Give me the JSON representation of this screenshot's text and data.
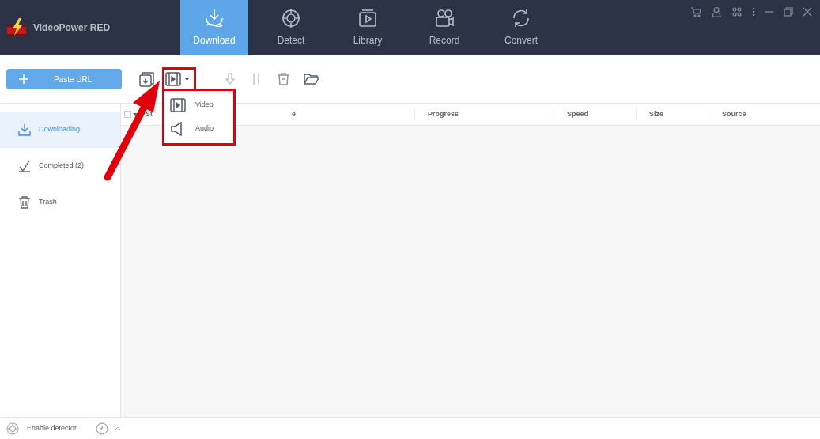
{
  "app": {
    "title": "VideoPower RED"
  },
  "tabs": [
    {
      "label": "Download",
      "selected": true
    },
    {
      "label": "Detect",
      "selected": false
    },
    {
      "label": "Library",
      "selected": false
    },
    {
      "label": "Record",
      "selected": false
    },
    {
      "label": "Convert",
      "selected": false
    }
  ],
  "toolbar": {
    "paste_button": "Paste URL"
  },
  "dropdown_menu": [
    {
      "label": "Video",
      "kind": "video"
    },
    {
      "label": "Audio",
      "kind": "audio"
    }
  ],
  "sidebar": {
    "items": [
      {
        "label": "Downloading",
        "kind": "download",
        "selected": true
      },
      {
        "label": "Completed (2)",
        "kind": "completed",
        "selected": false
      },
      {
        "label": "Trash",
        "kind": "trash",
        "selected": false
      }
    ]
  },
  "table": {
    "select_all_checked": false,
    "columns": [
      "St",
      "e",
      "Progress",
      "Speed",
      "Size",
      "Source"
    ]
  },
  "status_bar": {
    "detector": "Enable detector"
  }
}
